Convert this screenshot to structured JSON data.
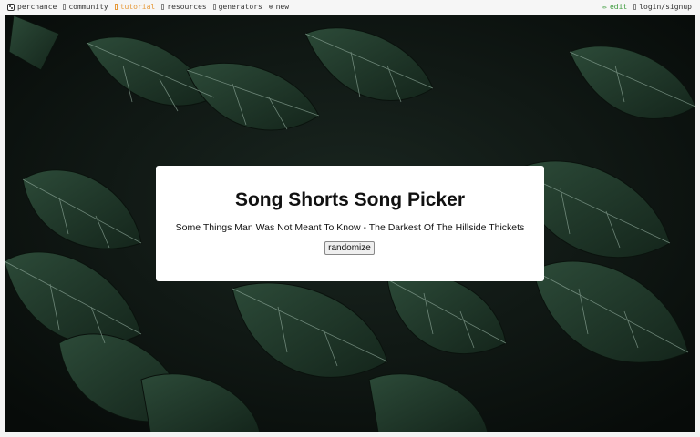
{
  "nav": {
    "left": [
      {
        "label": "perchance",
        "icon": "dice-icon"
      },
      {
        "label": "community",
        "icon": "chat-icon"
      },
      {
        "label": "tutorial",
        "icon": "book-icon",
        "color": "#e69a3b"
      },
      {
        "label": "resources",
        "icon": "link-icon"
      },
      {
        "label": "generators",
        "icon": "grid-icon"
      },
      {
        "label": "new",
        "icon": "plus-circle-icon"
      }
    ],
    "right": [
      {
        "label": "edit",
        "icon": "pencil-icon",
        "color": "#3a9a3a"
      },
      {
        "label": "login/signup",
        "icon": "user-icon"
      }
    ]
  },
  "generator": {
    "title": "Song Shorts Song Picker",
    "output": "Some Things Man Was Not Meant To Know - The Darkest Of The Hillside Thickets",
    "button_label": "randomize"
  },
  "colors": {
    "background_dark": "#0e1411",
    "leaf": "#1f3a2a",
    "leaf_vein": "#9fb7a8",
    "card": "#ffffff"
  }
}
